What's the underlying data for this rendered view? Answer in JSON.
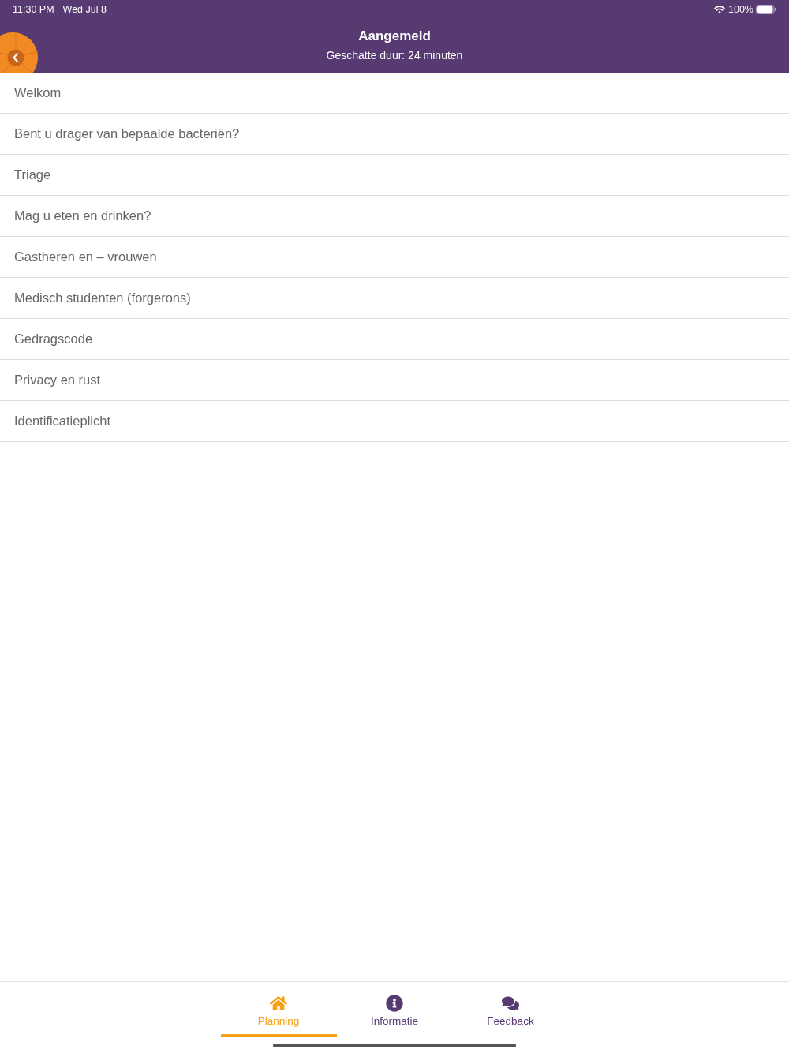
{
  "status_bar": {
    "time": "11:30 PM",
    "date": "Wed Jul 8",
    "battery": "100%"
  },
  "header": {
    "title": "Aangemeld",
    "subtitle": "Geschatte duur: 24 minuten"
  },
  "menu_items": [
    "Welkom",
    "Bent u drager van bepaalde bacteriën?",
    "Triage",
    "Mag u eten en drinken?",
    "Gastheren en – vrouwen",
    "Medisch studenten (forgerons)",
    "Gedragscode",
    "Privacy en rust",
    "Identificatieplicht"
  ],
  "tab_bar": {
    "tabs": [
      {
        "label": "Planning",
        "kind": "home",
        "selected": true
      },
      {
        "label": "Informatie",
        "kind": "info",
        "selected": false
      },
      {
        "label": "Feedback",
        "kind": "chat",
        "selected": false
      }
    ]
  }
}
